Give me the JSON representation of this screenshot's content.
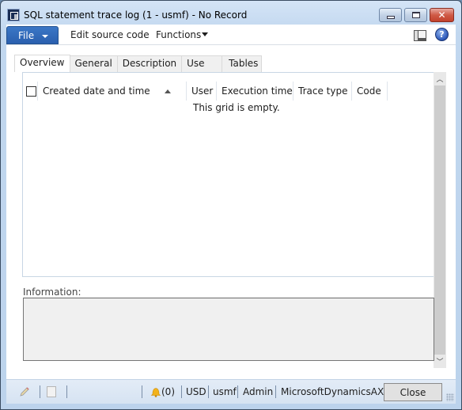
{
  "window": {
    "title": "SQL statement trace log (1 - usmf) - No Record",
    "icon": "dynamics-ax-app-icon",
    "caption_buttons": {
      "minimize": "minimize-icon",
      "maximize": "maximize-icon",
      "close": "✕"
    }
  },
  "ribbon": {
    "file_label": "File",
    "items": [
      "Edit source code",
      "Functions"
    ],
    "right_icons": [
      "layout-icon",
      "help-icon"
    ],
    "help_glyph": "?"
  },
  "tabs": [
    {
      "label": "Overview",
      "active": true
    },
    {
      "label": "General",
      "active": false
    },
    {
      "label": "Description",
      "active": false
    },
    {
      "label": "Use",
      "active": false
    },
    {
      "label": "Tables",
      "active": false
    }
  ],
  "grid": {
    "columns": [
      {
        "label": "Created date and time",
        "sort": "ascending"
      },
      {
        "label": "User"
      },
      {
        "label": "Execution time"
      },
      {
        "label": "Trace type"
      },
      {
        "label": "Code"
      }
    ],
    "empty_message": "This grid is empty."
  },
  "info": {
    "label": "Information:",
    "value": ""
  },
  "statusbar": {
    "notifications": "(0)",
    "currency": "USD",
    "company": "usmf",
    "user": "Admin",
    "partition": "MicrosoftDynamicsAX",
    "close_label": "Close"
  },
  "colors": {
    "file_button": "#2f67b4",
    "window_frame": "#c1d7ef",
    "close_caption": "#c7473a"
  }
}
